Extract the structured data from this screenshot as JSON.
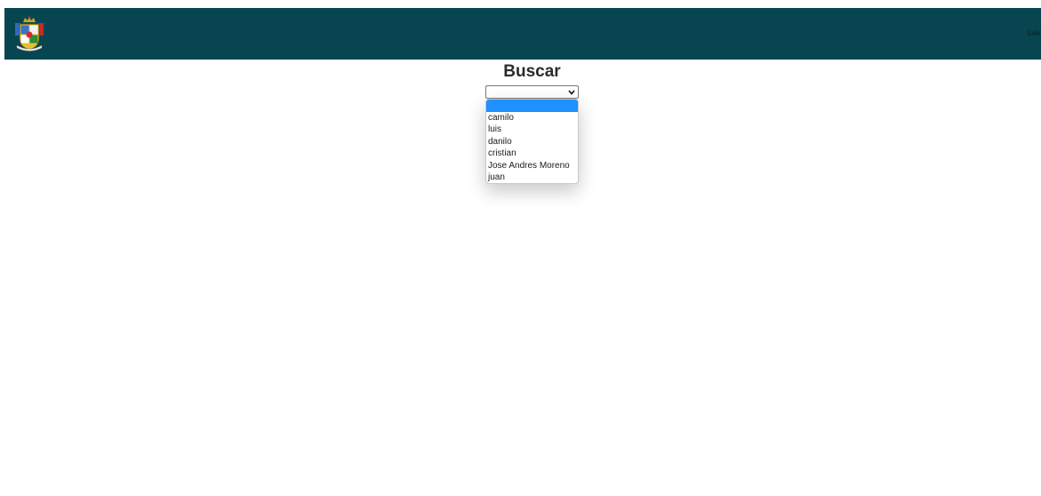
{
  "header": {
    "logo_icon": "coat-of-arms-icon",
    "exit_label": "Salir",
    "background_color": "#074650"
  },
  "main": {
    "title": "Buscar",
    "select": {
      "selected_value": "",
      "options": [
        "",
        "camilo",
        "luis",
        "danilo",
        "cristian",
        "Jose Andres Moreno",
        "juan"
      ],
      "highlight_color": "#1e90ff"
    }
  }
}
